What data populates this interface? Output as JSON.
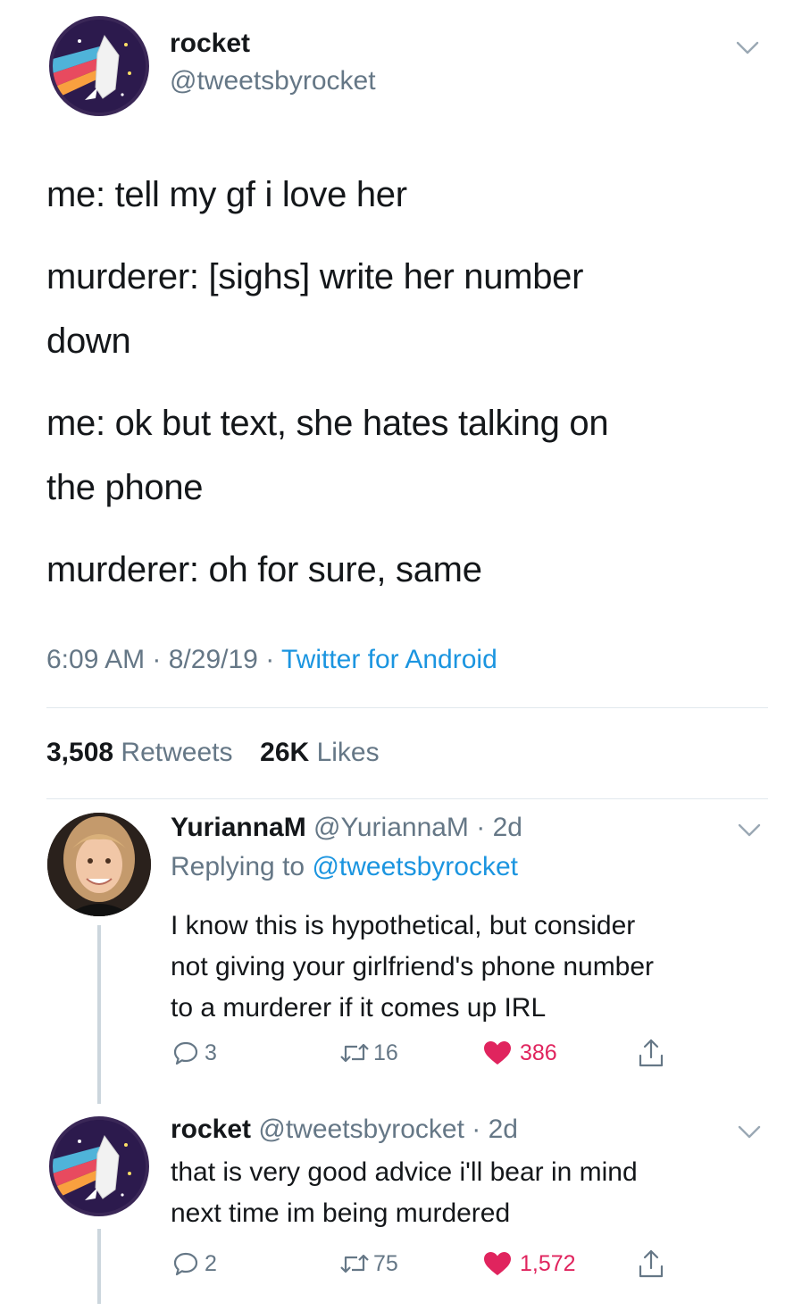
{
  "main_tweet": {
    "display_name": "rocket",
    "handle": "@tweetsbyrocket",
    "lines": [
      "me: tell my gf i love her",
      "murderer: [sighs] write her number",
      "down",
      "me: ok but text, she hates talking on",
      "the phone",
      "murderer: oh for sure, same"
    ],
    "time": "6:09 AM",
    "date": "8/29/19",
    "source": "Twitter for Android",
    "retweets_count": "3,508",
    "retweets_label": "Retweets",
    "likes_count": "26K",
    "likes_label": "Likes"
  },
  "replies": [
    {
      "display_name": "YuriannaM",
      "handle": "@YuriannaM",
      "age": "2d",
      "replying_label": "Replying to",
      "replying_handle": "@tweetsbyrocket",
      "lines": [
        "I know this is hypothetical, but consider",
        "not giving your girlfriend's phone number",
        "to a murderer if it comes up IRL"
      ],
      "reply_count": "3",
      "retweet_count": "16",
      "like_count": "386"
    },
    {
      "display_name": "rocket",
      "handle": "@tweetsbyrocket",
      "age": "2d",
      "lines": [
        "that is very good advice i'll bear in mind",
        "next time im being murdered"
      ],
      "reply_count": "2",
      "retweet_count": "75",
      "like_count": "1,572"
    }
  ],
  "colors": {
    "text": "#14171a",
    "muted": "#657786",
    "link": "#1b95e0",
    "like": "#e0245e",
    "divider": "#e1e8ed"
  },
  "icons": [
    "chevron-down-icon",
    "reply-icon",
    "retweet-icon",
    "heart-icon",
    "share-icon"
  ]
}
